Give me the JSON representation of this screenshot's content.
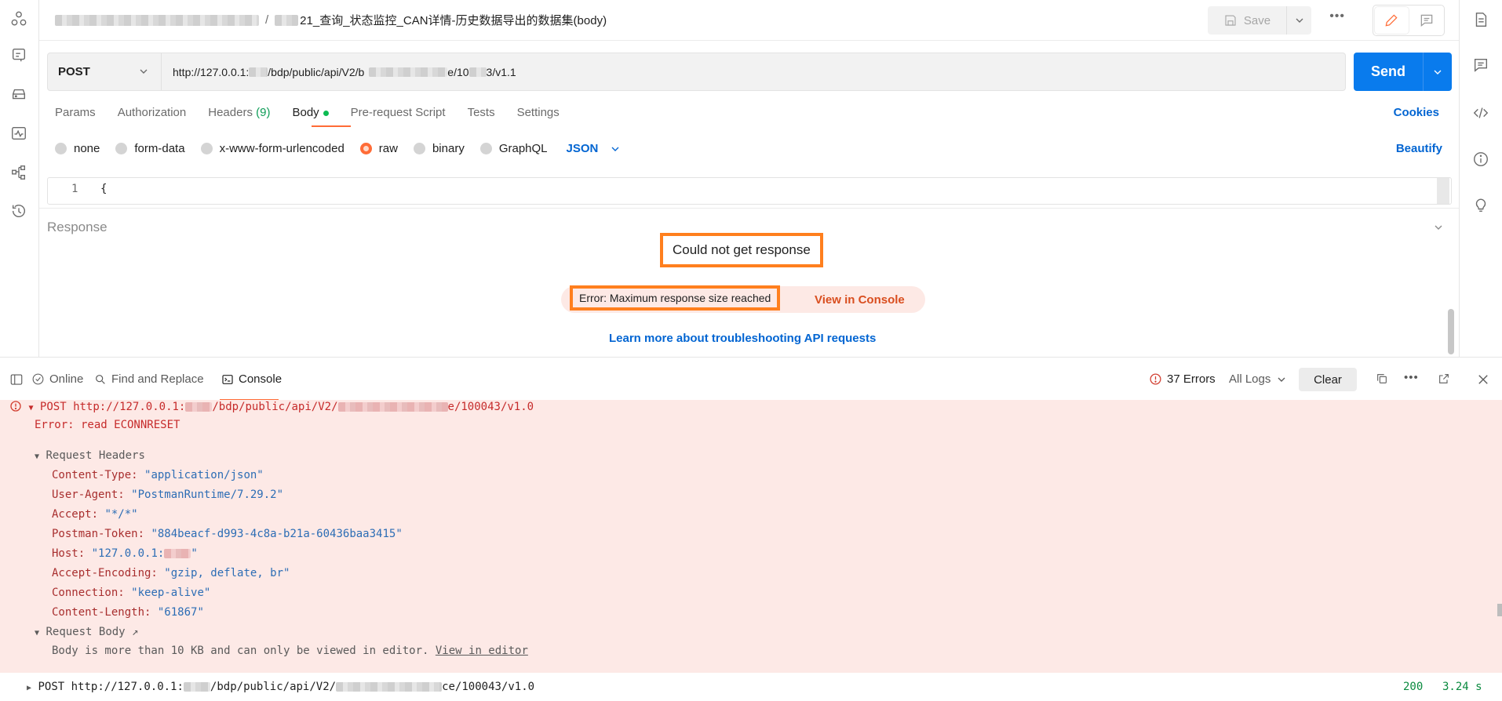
{
  "header": {
    "breadcrumb_sep": "/",
    "request_title": "21_查询_状态监控_CAN详情-历史数据导出的数据集(body)",
    "save_label": "Save",
    "more_label": "•••"
  },
  "request": {
    "method": "POST",
    "url_parts": [
      "http://127.0.0.1:",
      "/bdp/public/api/V2/b",
      "e/10",
      "3/v1.1"
    ],
    "send_label": "Send"
  },
  "tabs": [
    {
      "label": "Params"
    },
    {
      "label": "Authorization"
    },
    {
      "label": "Headers",
      "count": "(9)"
    },
    {
      "label": "Body"
    },
    {
      "label": "Pre-request Script"
    },
    {
      "label": "Tests"
    },
    {
      "label": "Settings"
    }
  ],
  "cookies_label": "Cookies",
  "body_types": [
    "none",
    "form-data",
    "x-www-form-urlencoded",
    "raw",
    "binary",
    "GraphQL"
  ],
  "body_language": "JSON",
  "beautify_label": "Beautify",
  "editor": {
    "line_numbers": [
      "1"
    ],
    "code": "{"
  },
  "response": {
    "label": "Response",
    "error_title": "Could not get response",
    "error_message": "Error: Maximum response size reached",
    "view_console": "View in Console",
    "learn_more": "Learn more about troubleshooting API requests"
  },
  "console_bar": {
    "online": "Online",
    "find_replace": "Find and Replace",
    "console": "Console",
    "errors": "37 Errors",
    "log_filter": "All Logs",
    "clear": "Clear"
  },
  "console_log": {
    "entry_method": "POST",
    "entry_url_start": "http://127.0.0.1:",
    "entry_url_mid": "/bdp/public/api/V2/",
    "entry_url_end": "e/100043/v1.0",
    "error": "Error: read ECONNRESET",
    "request_headers_label": "Request Headers",
    "headers": [
      {
        "key": "Content-Type:",
        "value": "\"application/json\""
      },
      {
        "key": "User-Agent:",
        "value": "\"PostmanRuntime/7.29.2\""
      },
      {
        "key": "Accept:",
        "value": "\"*/*\""
      },
      {
        "key": "Postman-Token:",
        "value": "\"884beacf-d993-4c8a-b21a-60436baa3415\""
      },
      {
        "key": "Host:",
        "value": "\"127.0.0.1:"
      },
      {
        "key": "Accept-Encoding:",
        "value": "\"gzip, deflate, br\""
      },
      {
        "key": "Connection:",
        "value": "\"keep-alive\""
      },
      {
        "key": "Content-Length:",
        "value": "\"61867\""
      }
    ],
    "host_end": "\"",
    "request_body_label": "Request Body",
    "request_body_arrow": "↗",
    "body_note": "Body is more than 10 KB and can only be viewed in editor.",
    "view_in_editor": "View in editor",
    "second_entry_url_end": "ce/100043/v1.0",
    "second_status": "200",
    "second_time": "3.24 s"
  }
}
